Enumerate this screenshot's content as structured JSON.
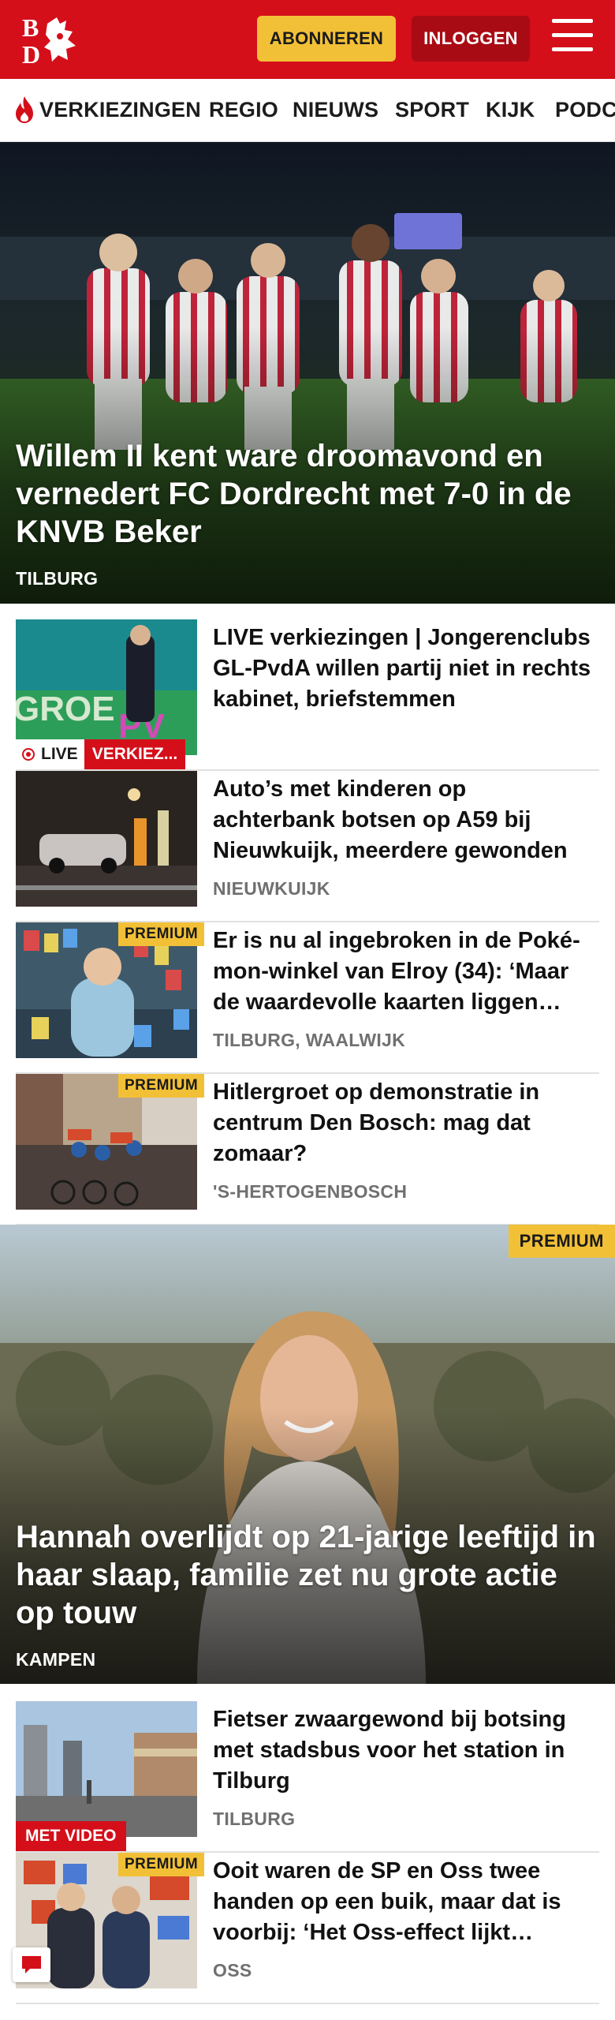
{
  "header": {
    "logo_text": "BD",
    "subscribe_label": "ABONNEREN",
    "login_label": "INLOGGEN",
    "menu_icon": "hamburger-menu-icon",
    "brand_color": "#d40f1a",
    "accent_color": "#f2c037"
  },
  "nav": {
    "items": [
      {
        "label": "VERKIEZINGEN",
        "icon": "flame-icon"
      },
      {
        "label": "REGIO"
      },
      {
        "label": "NIEUWS"
      },
      {
        "label": "SPORT"
      },
      {
        "label": "KIJK"
      },
      {
        "label": "PODC"
      }
    ]
  },
  "hero1": {
    "title": "Willem II kent ware droomavond en vernedert FC Dordrecht met 7-0 in de KNVB Beker",
    "location": "TILBURG"
  },
  "articles": [
    {
      "title": "LIVE verkiezingen | Jongeren­clubs GL-PvdA willen partij niet in rechts kabinet, briefstemmen",
      "live_label": "LIVE",
      "category_label": "VERKIEZ..."
    },
    {
      "title": "Auto’s met kinderen op achterbank botsen op A59 bij Nieuwkuijk, meerdere gewonden",
      "location": "NIEUWKUIJK"
    },
    {
      "title": "Er is nu al ingebroken in de Poké­mon-winkel van Elroy (34): ‘Maar de waardevolle kaarten liggen veilig’",
      "location": "TILBURG, WAALWIJK",
      "premium_label": "PREMIUM"
    },
    {
      "title": "Hitlergroet op demonstratie in centrum Den Bosch: mag dat zomaar?",
      "location": "'S-HERTOGENBOSCH",
      "premium_label": "PREMIUM"
    }
  ],
  "hero2": {
    "title": "Hannah overlijdt op 21-jarige leeftijd in haar slaap, familie zet nu grote actie op touw",
    "location": "KAMPEN",
    "premium_label": "PREMIUM"
  },
  "articles2": [
    {
      "title": "Fietser zwaargewond bij botsing met stadsbus voor het station in Tilburg",
      "location": "TILBURG",
      "video_label": "MET VIDEO"
    },
    {
      "title": "Ooit waren de SP en Oss twee handen op een buik, maar dat is voorbij: ‘Het Oss-effect lijkt voorbij’",
      "location": "OSS",
      "premium_label": "PREMIUM"
    }
  ],
  "chat_icon": "chat-bubble-icon"
}
